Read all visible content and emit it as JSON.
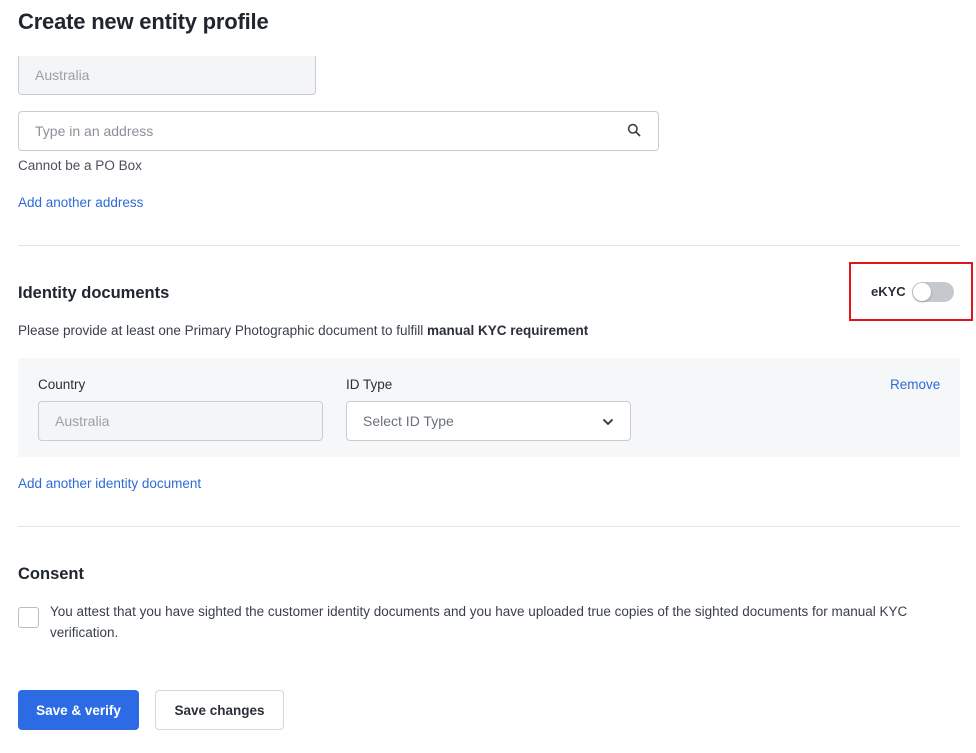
{
  "page": {
    "title": "Create new entity profile"
  },
  "address": {
    "country_value": "Australia",
    "address_placeholder": "Type in an address",
    "helper": "Cannot be a PO Box",
    "add_link": "Add another address"
  },
  "identity": {
    "title": "Identity documents",
    "ekyc_label": "eKYC",
    "ekyc_enabled": false,
    "description_prefix": "Please provide at least one Primary Photographic document to fulfill ",
    "description_bold": "manual KYC requirement",
    "document": {
      "country_label": "Country",
      "country_value": "Australia",
      "id_type_label": "ID Type",
      "id_type_placeholder": "Select ID Type",
      "remove_label": "Remove"
    },
    "add_link": "Add another identity document"
  },
  "consent": {
    "title": "Consent",
    "checked": false,
    "text": "You attest that you have sighted the customer identity documents and you have uploaded true copies of the sighted documents for manual KYC verification."
  },
  "actions": {
    "save_verify": "Save & verify",
    "save_changes": "Save changes"
  },
  "colors": {
    "accent": "#2d6be4",
    "link": "#2c6bd6",
    "highlight": "#e0141a"
  }
}
